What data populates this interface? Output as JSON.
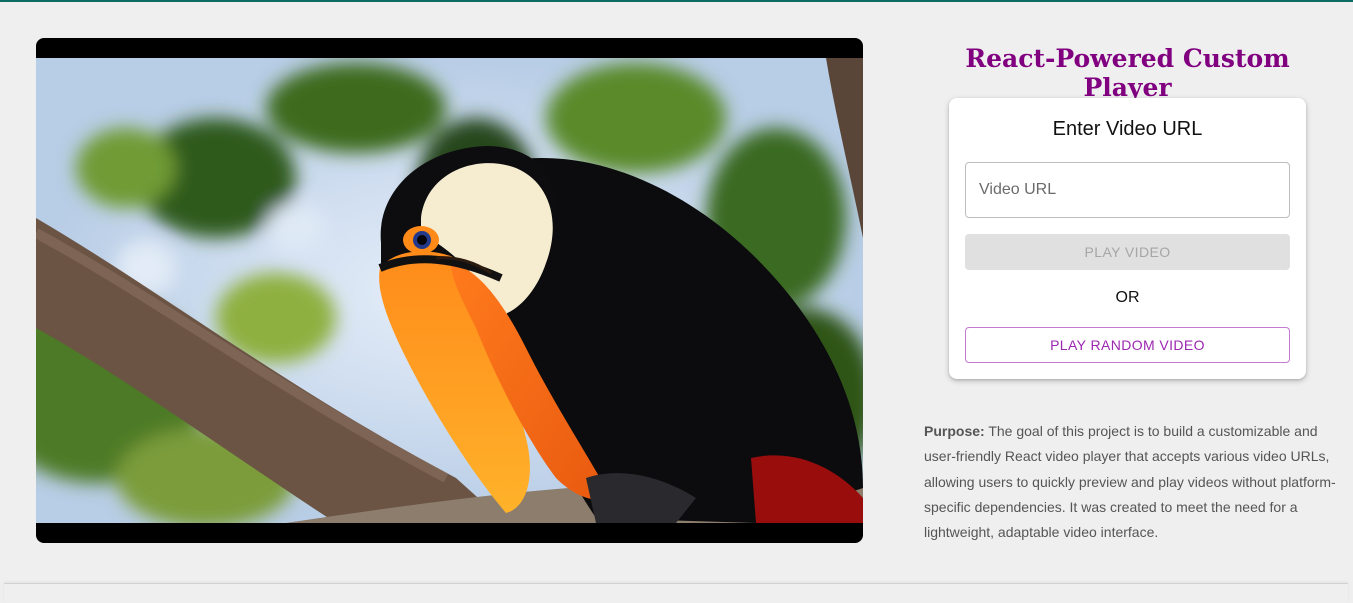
{
  "colors": {
    "accent_line": "#0e6b63",
    "title": "#800080",
    "random_button": "#9c27b0"
  },
  "header": {
    "title": "React-Powered Custom Player"
  },
  "player": {
    "icon": "toucan-video-frame"
  },
  "url_card": {
    "heading": "Enter Video URL",
    "input_placeholder": "Video URL",
    "input_value": "",
    "play_button": "PLAY VIDEO",
    "or_text": "OR",
    "random_button": "PLAY RANDOM VIDEO"
  },
  "purpose": {
    "label": "Purpose:",
    "text": "The goal of this project is to build a customizable and user-friendly React video player that accepts various video URLs, allowing users to quickly preview and play videos without platform-specific dependencies. It was created to meet the need for a lightweight, adaptable video interface."
  }
}
